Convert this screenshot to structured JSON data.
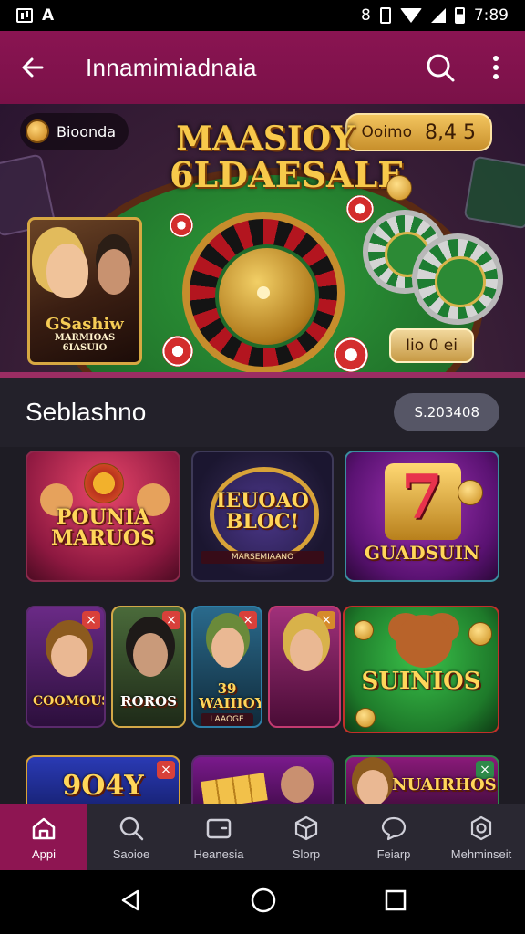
{
  "status_bar": {
    "left_glyph": "A",
    "battery_glyph": "8",
    "time": "7:89"
  },
  "app_bar": {
    "title": "Innamimiadnaia"
  },
  "hero": {
    "badge_left": "Bioonda",
    "headline_line1": "MAASIOY",
    "headline_line2": "6LDAESALE",
    "badge_right_label": "Ooimo",
    "badge_right_value": "8,4 5",
    "poster_line1": "GSashiw",
    "poster_line2": "MARMIOAS",
    "poster_line3": "6IASUIO",
    "badge_bottom": "Iio 0 ei"
  },
  "section": {
    "title": "Seblashno",
    "pill": "S.203408"
  },
  "tiles": [
    {
      "title": "POUNIA MARUOS",
      "sub": ""
    },
    {
      "title": "IEUOAO BLOC!",
      "sub": "MARSEMIAANO"
    },
    {
      "title": "GUADSUIN",
      "sub": ""
    },
    {
      "title": "COOMOUS",
      "sub": ""
    },
    {
      "title": "ROROS",
      "sub": ""
    },
    {
      "title": "39 WAIIIOY",
      "sub": "LAAOGE"
    },
    {
      "title": "SUINIOS",
      "sub": ""
    },
    {
      "title": "9O4Y",
      "sub": ""
    },
    {
      "title": "",
      "sub": ""
    },
    {
      "title": "NUAIRHOS",
      "sub": ""
    }
  ],
  "bottom_nav": [
    {
      "label": "Appi",
      "icon": "home-icon",
      "active": true
    },
    {
      "label": "Saoioe",
      "icon": "search-icon",
      "active": false
    },
    {
      "label": "Heanesia",
      "icon": "wallet-icon",
      "active": false
    },
    {
      "label": "Slorp",
      "icon": "cube-icon",
      "active": false
    },
    {
      "label": "Feiarp",
      "icon": "chat-icon",
      "active": false
    },
    {
      "label": "Mehminseit",
      "icon": "settings-icon",
      "active": false
    }
  ],
  "colors": {
    "brand": "#8a1452",
    "gold": "#f7c94b",
    "nav_active": "#8e1552"
  }
}
